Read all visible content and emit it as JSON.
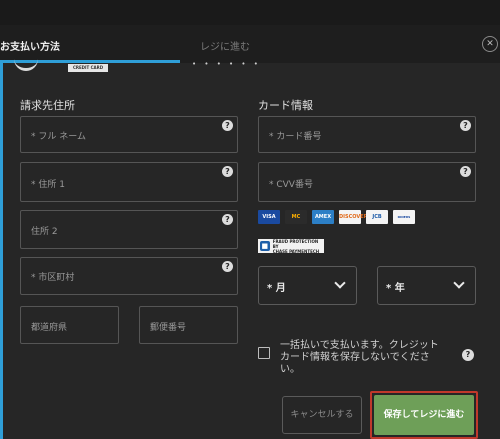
{
  "tabs": {
    "payment_label": "お支払い方法",
    "checkout_label": "レジに進む"
  },
  "close_glyph": "✕",
  "badge": {
    "credit_card": "CREDIT CARD"
  },
  "partial_text": "• • • • • •",
  "billing": {
    "title": "請求先住所",
    "full_name_placeholder": "* フル ネーム",
    "address1_placeholder": "* 住所 1",
    "address2_placeholder": "住所 2",
    "city_placeholder": "* 市区町村",
    "prefecture_placeholder": "都道府県",
    "postal_placeholder": "郵便番号"
  },
  "card": {
    "title": "カード情報",
    "number_placeholder": "* カード番号",
    "cvv_placeholder": "* CVV番号",
    "logos": [
      "VISA",
      "MC",
      "AMEX",
      "DISCOVER",
      "JCB",
      "DINERS"
    ],
    "chase_text": "FRAUD PROTECTION BY\nCHASE PAYMENTECH",
    "month_value": "* 月",
    "year_value": "* 年"
  },
  "help_glyph": "?",
  "consent_text": "一括払いで支払います。クレジットカード情報を保存しないでください。",
  "buttons": {
    "cancel": "キャンセルする",
    "save": "保存してレジに進む"
  },
  "colors": {
    "accent": "#2f9fd8",
    "save_bg": "#6e9f58",
    "save_outline": "#c0392b"
  }
}
